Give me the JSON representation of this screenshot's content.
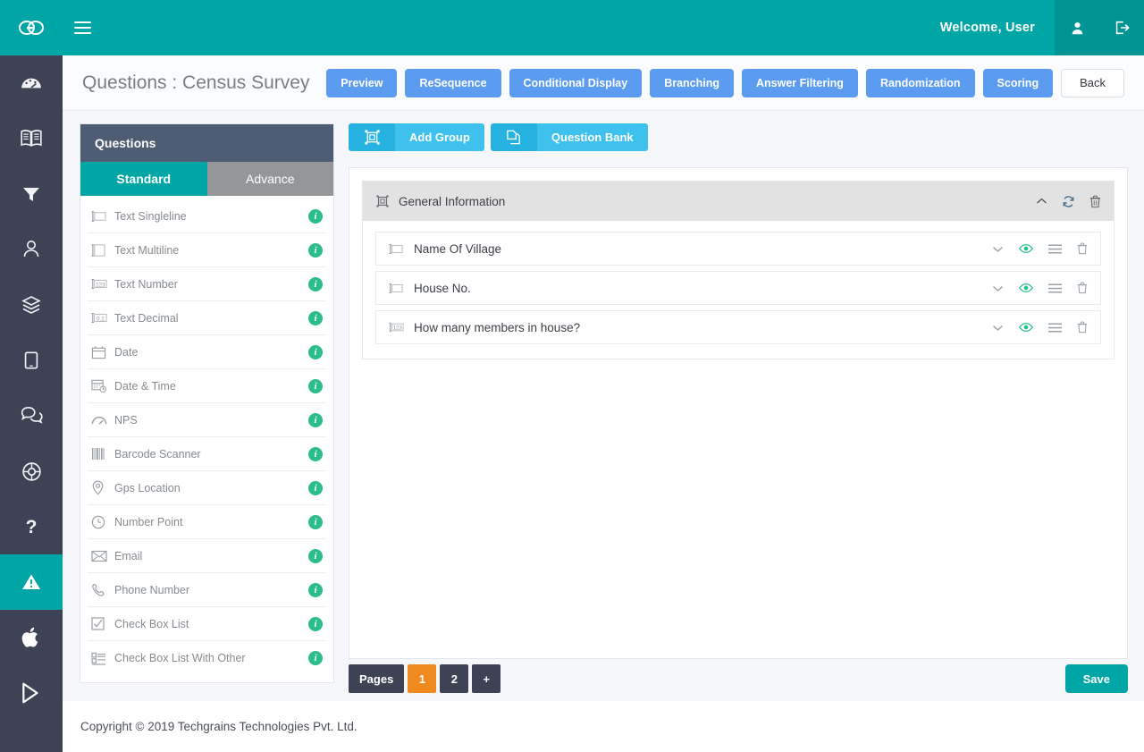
{
  "topbar": {
    "logo_icon": "goo-logo-icon",
    "menu_toggle_icon": "hamburger-icon",
    "welcome_text": "Welcome, User",
    "profile_icon": "user-icon",
    "logout_icon": "logout-icon",
    "background_color": "#00a6a6"
  },
  "rail": {
    "items": [
      {
        "icon": "dashboard-gauge-icon",
        "active": false
      },
      {
        "icon": "book-icon",
        "active": false
      },
      {
        "icon": "filter-funnel-icon",
        "active": false
      },
      {
        "icon": "user-icon",
        "active": false
      },
      {
        "icon": "layers-icon",
        "active": false
      },
      {
        "icon": "tablet-icon",
        "active": false
      },
      {
        "icon": "chat-bubbles-icon",
        "active": false
      },
      {
        "icon": "lifebuoy-icon",
        "active": false
      },
      {
        "icon": "question-mark-icon",
        "active": false
      },
      {
        "icon": "warning-triangle-icon",
        "active": true
      },
      {
        "icon": "apple-icon",
        "active": false
      },
      {
        "icon": "play-store-icon",
        "active": false
      }
    ],
    "active_color": "#00a6a6",
    "background_color": "#3d4255"
  },
  "header": {
    "title": "Questions : Census Survey",
    "buttons": [
      {
        "label": "Preview",
        "style": "blue"
      },
      {
        "label": "ReSequence",
        "style": "blue"
      },
      {
        "label": "Conditional Display",
        "style": "blue"
      },
      {
        "label": "Branching",
        "style": "blue"
      },
      {
        "label": "Answer Filtering",
        "style": "blue"
      },
      {
        "label": "Randomization",
        "style": "blue"
      },
      {
        "label": "Scoring",
        "style": "blue"
      }
    ],
    "back_label": "Back",
    "blue_color": "#5b9bf0"
  },
  "questions_panel": {
    "title": "Questions",
    "tabs": [
      {
        "label": "Standard",
        "active": true
      },
      {
        "label": "Advance",
        "active": false
      }
    ],
    "items": [
      {
        "label": "Text Singleline",
        "icon": "text-singleline-icon",
        "info": "i"
      },
      {
        "label": "Text Multiline",
        "icon": "text-multiline-icon",
        "info": "i"
      },
      {
        "label": "Text Number",
        "icon": "text-number-icon",
        "info": "i"
      },
      {
        "label": "Text Decimal",
        "icon": "text-decimal-icon",
        "info": "i"
      },
      {
        "label": "Date",
        "icon": "calendar-icon",
        "info": "i"
      },
      {
        "label": "Date & Time",
        "icon": "calendar-clock-icon",
        "info": "i"
      },
      {
        "label": "NPS",
        "icon": "gauge-icon",
        "info": "i"
      },
      {
        "label": "Barcode Scanner",
        "icon": "barcode-icon",
        "info": "i"
      },
      {
        "label": "Gps Location",
        "icon": "map-pin-icon",
        "info": "i"
      },
      {
        "label": "Number Point",
        "icon": "clock-circle-icon",
        "info": "i"
      },
      {
        "label": "Email",
        "icon": "envelope-icon",
        "info": "i"
      },
      {
        "label": "Phone Number",
        "icon": "phone-icon",
        "info": "i"
      },
      {
        "label": "Check Box List",
        "icon": "checkbox-icon",
        "info": "i"
      },
      {
        "label": "Check Box List With Other",
        "icon": "checkbox-list-icon",
        "info": "i"
      }
    ]
  },
  "main": {
    "toolbar": [
      {
        "label": "Add Group",
        "icon": "group-frame-icon"
      },
      {
        "label": "Question Bank",
        "icon": "copy-pages-icon"
      }
    ],
    "groups": [
      {
        "title": "General Information",
        "icon": "group-frame-icon",
        "actions": [
          {
            "icon": "chevron-up-icon"
          },
          {
            "icon": "refresh-icon"
          },
          {
            "icon": "trash-icon"
          }
        ],
        "questions": [
          {
            "label": "Name Of Village",
            "icon": "text-singleline-icon",
            "actions": [
              {
                "icon": "chevron-down-icon"
              },
              {
                "icon": "eye-icon"
              },
              {
                "icon": "list-icon"
              },
              {
                "icon": "trash-icon"
              }
            ]
          },
          {
            "label": "House No.",
            "icon": "text-singleline-icon",
            "actions": [
              {
                "icon": "chevron-down-icon"
              },
              {
                "icon": "eye-icon"
              },
              {
                "icon": "list-icon"
              },
              {
                "icon": "trash-icon"
              }
            ]
          },
          {
            "label": "How many members in house?",
            "icon": "text-number-icon",
            "actions": [
              {
                "icon": "chevron-down-icon"
              },
              {
                "icon": "eye-icon"
              },
              {
                "icon": "list-icon"
              },
              {
                "icon": "trash-icon"
              }
            ]
          }
        ]
      }
    ]
  },
  "pagination": {
    "label": "Pages",
    "pages": [
      {
        "label": "1",
        "active": true
      },
      {
        "label": "2",
        "active": false
      }
    ],
    "add_label": "+",
    "active_color": "#ef8a20"
  },
  "save_button": {
    "label": "Save",
    "color": "#00a6a6"
  },
  "footer": {
    "copyright": "Copyright © 2019 Techgrains Technologies Pvt. Ltd."
  }
}
